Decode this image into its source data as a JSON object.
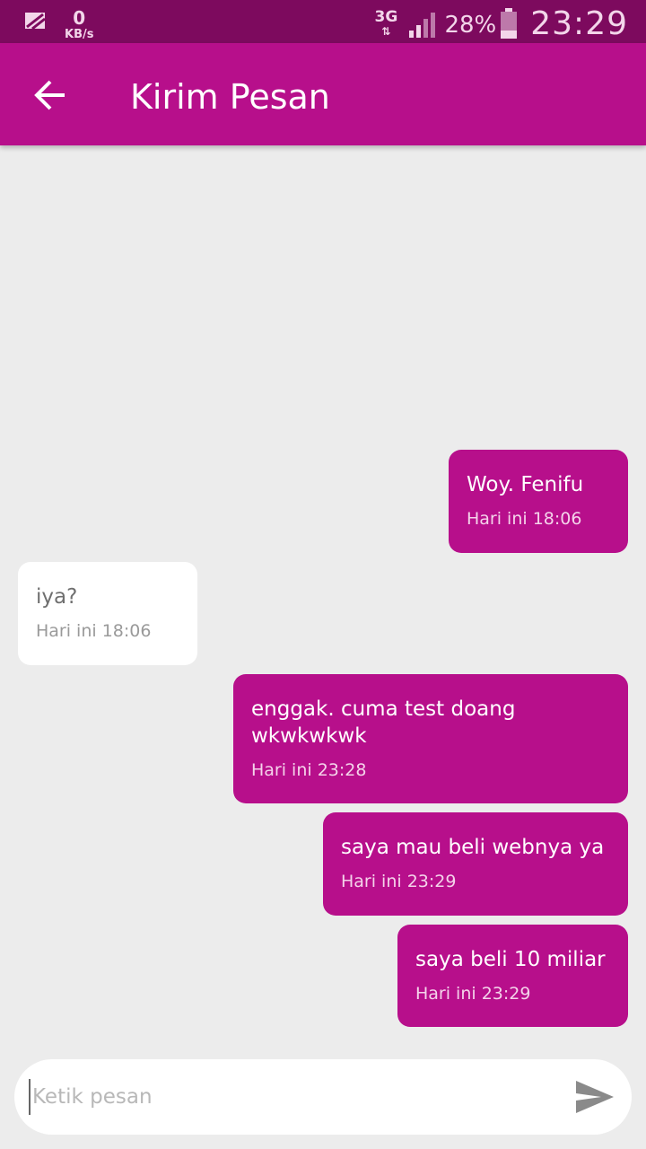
{
  "status_bar": {
    "net_speed_value": "0",
    "net_speed_unit": "KB/s",
    "network_type": "3G",
    "network_arrows": "⇅",
    "battery_percent": "28%",
    "time": "23:29"
  },
  "app_bar": {
    "title": "Kirim Pesan"
  },
  "messages": [
    {
      "direction": "out",
      "text": "Woy. Fenifu",
      "time": "Hari ini 18:06"
    },
    {
      "direction": "in",
      "text": "iya?",
      "time": "Hari ini 18:06"
    },
    {
      "direction": "out",
      "text": "enggak. cuma test doang wkwkwkwk",
      "time": "Hari ini 23:28"
    },
    {
      "direction": "out",
      "text": "saya mau beli webnya ya",
      "time": "Hari ini 23:29"
    },
    {
      "direction": "out",
      "text": "saya beli 10 miliar",
      "time": "Hari ini 23:29"
    }
  ],
  "composer": {
    "placeholder": "Ketik pesan",
    "value": ""
  },
  "colors": {
    "status_bar": "#7d0a5e",
    "primary": "#b70f8b",
    "background": "#ececec",
    "incoming_bubble": "#ffffff"
  }
}
